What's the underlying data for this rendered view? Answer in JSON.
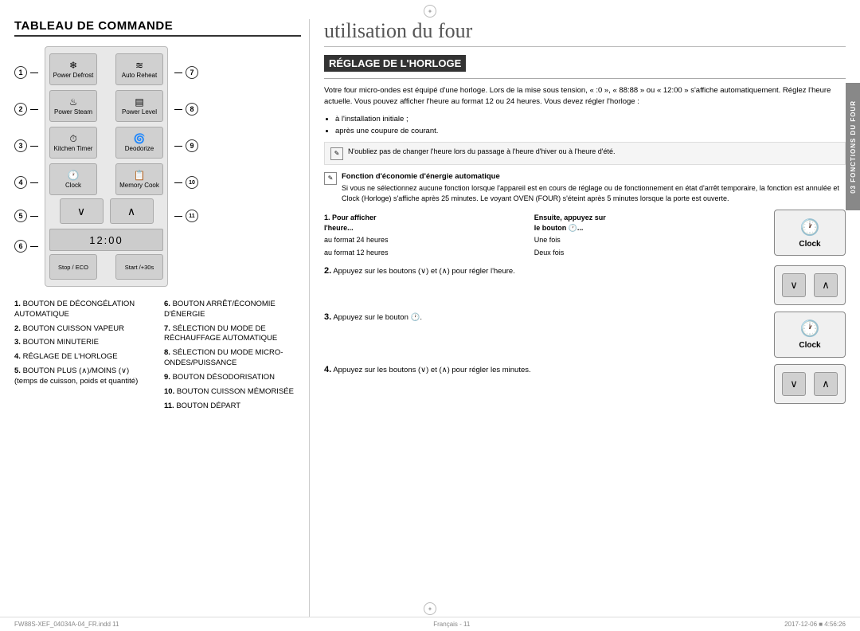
{
  "page": {
    "compass_symbol": "✦",
    "title": "utilisation du four",
    "left_section_title": "TABLEAU DE COMMANDE",
    "right_section_title": "RÉGLAGE DE L'HORLOGE"
  },
  "control_panel": {
    "buttons": [
      {
        "row": 1,
        "left_icon": "❄️",
        "left_label": "Power Defrost",
        "right_icon": "🔥",
        "right_label": "Auto Reheat"
      },
      {
        "row": 2,
        "left_icon": "♨",
        "left_label": "Power Steam",
        "right_icon": "▦",
        "right_label": "Power Level"
      },
      {
        "row": 3,
        "left_icon": "⏱",
        "left_label": "Kitchen Timer",
        "right_icon": "🌀",
        "right_label": "Deodorize"
      },
      {
        "row": 4,
        "left_icon": "🕐",
        "left_label": "Clock",
        "right_icon": "📋",
        "right_label": "Memory Cook"
      }
    ],
    "arrow_row": {
      "down": "∨",
      "up": "∧"
    },
    "bottom_left": "Stop / ECO",
    "bottom_right": "Start /+30s"
  },
  "number_labels_left": [
    "1",
    "2",
    "3",
    "4",
    "5",
    "6"
  ],
  "number_labels_right": [
    "7",
    "8",
    "9",
    "10",
    "11"
  ],
  "legend": {
    "col1": [
      {
        "num": "1",
        "text": "BOUTON DE DÉCONGÉLATION AUTOMATIQUE"
      },
      {
        "num": "2",
        "text": "BOUTON CUISSON VAPEUR"
      },
      {
        "num": "3",
        "text": "BOUTON MINUTERIE"
      },
      {
        "num": "4",
        "text": "RÉGLAGE DE L'HORLOGE"
      },
      {
        "num": "5",
        "text": "BOUTON PLUS (∧)/MOINS (∨) (temps de cuisson, poids et quantité)"
      }
    ],
    "col2": [
      {
        "num": "6",
        "text": "BOUTON ARRÊT/ÉCONOMIE D'ÉNERGIE"
      },
      {
        "num": "7",
        "text": "SÉLECTION DU MODE DE RÉCHAUFFAGE AUTOMATIQUE"
      },
      {
        "num": "8",
        "text": "SÉLECTION DU MODE MICRO-ONDES/PUISSANCE"
      },
      {
        "num": "9",
        "text": "BOUTON DÉSODORISATION"
      },
      {
        "num": "10",
        "text": "BOUTON CUISSON MÉMORISÉE"
      },
      {
        "num": "11",
        "text": "BOUTON DÉPART"
      }
    ]
  },
  "right_section": {
    "intro": "Votre four micro-ondes est équipé d'une horloge. Lors de la mise sous tension, « :0 », « 88:88 » ou « 12:00 » s'affiche automatiquement. Réglez l'heure actuelle. Vous pouvez afficher l'heure au format 12 ou 24 heures. Vous devez régler l'horloge :",
    "bullets": [
      "à l'installation initiale ;",
      "après une coupure de courant."
    ],
    "note1": "N'oubliez pas de changer l'heure lors du passage à l'heure d'hiver ou à l'heure d'été.",
    "function_heading": "Fonction d'économie d'énergie automatique",
    "function_text": "Si vous ne sélectionnez aucune fonction lorsque l'appareil est en cours de réglage ou de fonctionnement en état d'arrêt temporaire, la fonction est annulée et Clock (Horloge) s'affiche après 25 minutes. Le voyant OVEN (FOUR) s'éteint après 5 minutes lorsque la porte est ouverte.",
    "steps": [
      {
        "num": "1.",
        "col1_heading": "Pour afficher l'heure...",
        "col2_heading": "Ensuite, appuyez sur le bouton 🕐...",
        "rows": [
          {
            "col1": "au format 24 heures",
            "col2": "Une fois"
          },
          {
            "col1": "au format 12 heures",
            "col2": "Deux fois"
          }
        ],
        "button_type": "clock"
      },
      {
        "num": "2.",
        "text": "Appuyez sur les boutons (∨) et (∧) pour régler l'heure.",
        "button_type": "arrows"
      },
      {
        "num": "3.",
        "text": "Appuyez sur le bouton 🕐.",
        "button_type": "clock"
      },
      {
        "num": "4.",
        "text": "Appuyez sur les boutons (∨) et (∧) pour régler les minutes.",
        "button_type": "arrows"
      }
    ]
  },
  "sidebar_tab": "03  FONCTIONS DU FOUR",
  "footer": {
    "left": "FW88S-XEF_04034A-04_FR.indd  11",
    "center": "Français - 11",
    "right": "2017-12-06  ■  4:56:26"
  },
  "clock_button": {
    "label": "Clock",
    "icon": "🕐"
  },
  "arrow_up": "∧",
  "arrow_down": "∨"
}
